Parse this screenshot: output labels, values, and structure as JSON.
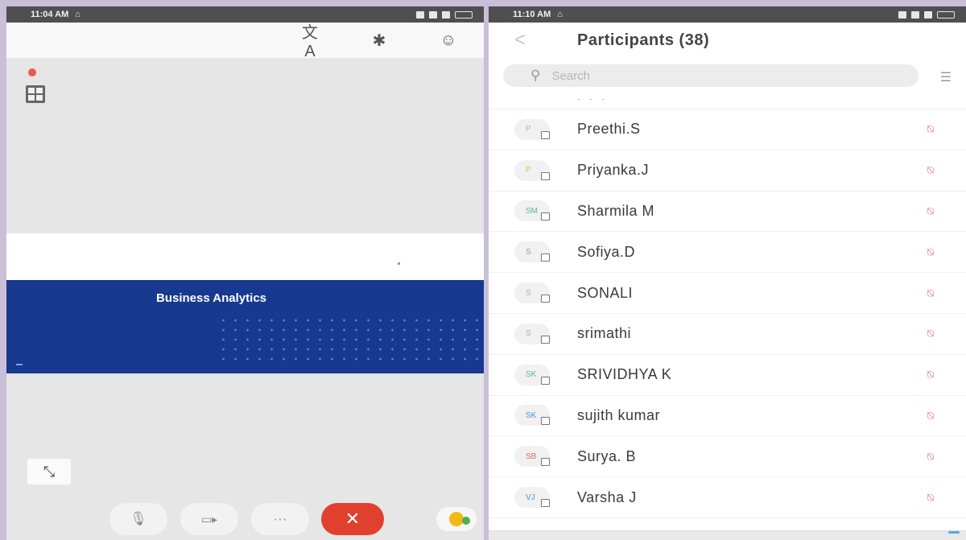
{
  "left_phone": {
    "statusbar": {
      "time": "11:04 AM"
    },
    "toolbar": {
      "icons": [
        "translate-icon",
        "bluetooth-icon",
        "participants-icon"
      ]
    },
    "slide": {
      "title": "Business Analytics"
    },
    "controls": {
      "icons": [
        "mute-mic-icon",
        "video-off-icon",
        "more-icon",
        "end-call-icon",
        "reaction-emoji-icon"
      ]
    },
    "colors": {
      "end_call": "#e2402f",
      "slide_blue": "#17398f",
      "recording": "#e85a4a"
    }
  },
  "right_phone": {
    "statusbar": {
      "time": "11:10 AM"
    },
    "header": {
      "title": "Participants (38)"
    },
    "search": {
      "placeholder": "Search"
    },
    "participants": [
      {
        "initials": "P",
        "name": "Preethi.S",
        "color": "#e9a2a2"
      },
      {
        "initials": "P",
        "name": "Priyanka.J",
        "color": "#d8c35a"
      },
      {
        "initials": "SM",
        "name": "Sharmila M",
        "color": "#58b3a8"
      },
      {
        "initials": "S",
        "name": "Sofiya.D",
        "color": "#7db86a"
      },
      {
        "initials": "S",
        "name": "SONALI",
        "color": "#e39b9b"
      },
      {
        "initials": "S",
        "name": "srimathi",
        "color": "#e39b9b"
      },
      {
        "initials": "SK",
        "name": "SRIVIDHYA K",
        "color": "#58b3a8"
      },
      {
        "initials": "SK",
        "name": "sujith kumar",
        "color": "#4a90d9"
      },
      {
        "initials": "SB",
        "name": "Surya. B",
        "color": "#e06a6a"
      },
      {
        "initials": "VJ",
        "name": "Varsha J",
        "color": "#4a90d9"
      }
    ]
  }
}
